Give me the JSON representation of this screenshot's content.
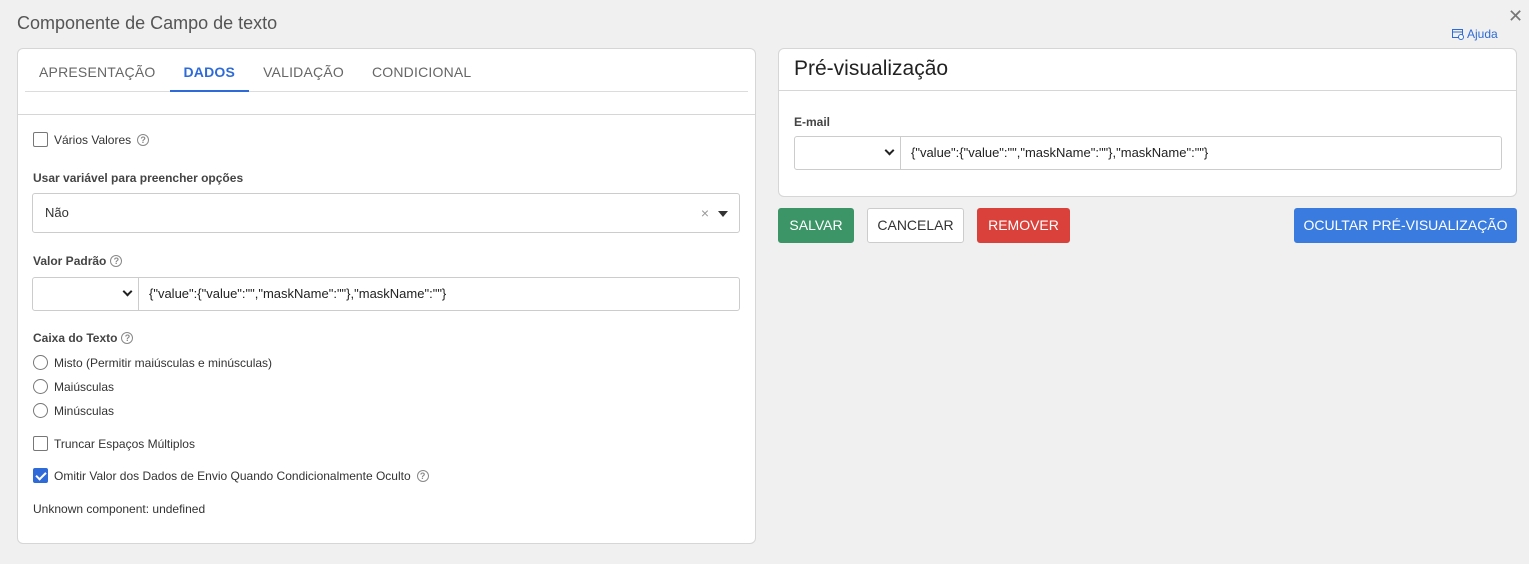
{
  "dialog": {
    "title": "Componente de Campo de texto",
    "close_glyph": "✕",
    "help_label": "Ajuda"
  },
  "tabs": [
    {
      "label": "APRESENTAÇÃO",
      "active": false
    },
    {
      "label": "DADOS",
      "active": true
    },
    {
      "label": "VALIDAÇÃO",
      "active": false
    },
    {
      "label": "CONDICIONAL",
      "active": false
    }
  ],
  "form": {
    "multiple_values": {
      "label": "Vários Valores",
      "checked": false
    },
    "use_variable": {
      "label": "Usar variável para preencher opções",
      "value": "Não",
      "clear_glyph": "×"
    },
    "default_value": {
      "label": "Valor Padrão",
      "select_value": "",
      "input_value": "{\"value\":{\"value\":\"\",\"maskName\":\"\"},\"maskName\":\"\"}"
    },
    "text_case": {
      "label": "Caixa do Texto",
      "options": [
        {
          "label": "Misto (Permitir maiúsculas e minúsculas)",
          "selected": false
        },
        {
          "label": "Maiúsculas",
          "selected": false
        },
        {
          "label": "Minúsculas",
          "selected": false
        }
      ]
    },
    "truncate_spaces": {
      "label": "Truncar Espaços Múltiplos",
      "checked": false
    },
    "omit_value": {
      "label": "Omitir Valor dos Dados de Envio Quando Condicionalmente Oculto",
      "checked": true
    },
    "unknown_component": "Unknown component: undefined"
  },
  "preview": {
    "title": "Pré-visualização",
    "field_label": "E-mail",
    "select_value": "",
    "input_value": "{\"value\":{\"value\":\"\",\"maskName\":\"\"},\"maskName\":\"\"}"
  },
  "buttons": {
    "save": "SALVAR",
    "cancel": "CANCELAR",
    "remove": "REMOVER",
    "hide_preview": "OCULTAR PRÉ-VISUALIZAÇÃO"
  },
  "colors": {
    "accent": "#2e6bd8",
    "save": "#3b9567",
    "remove": "#d9413a",
    "hide_preview": "#3a7be0"
  }
}
